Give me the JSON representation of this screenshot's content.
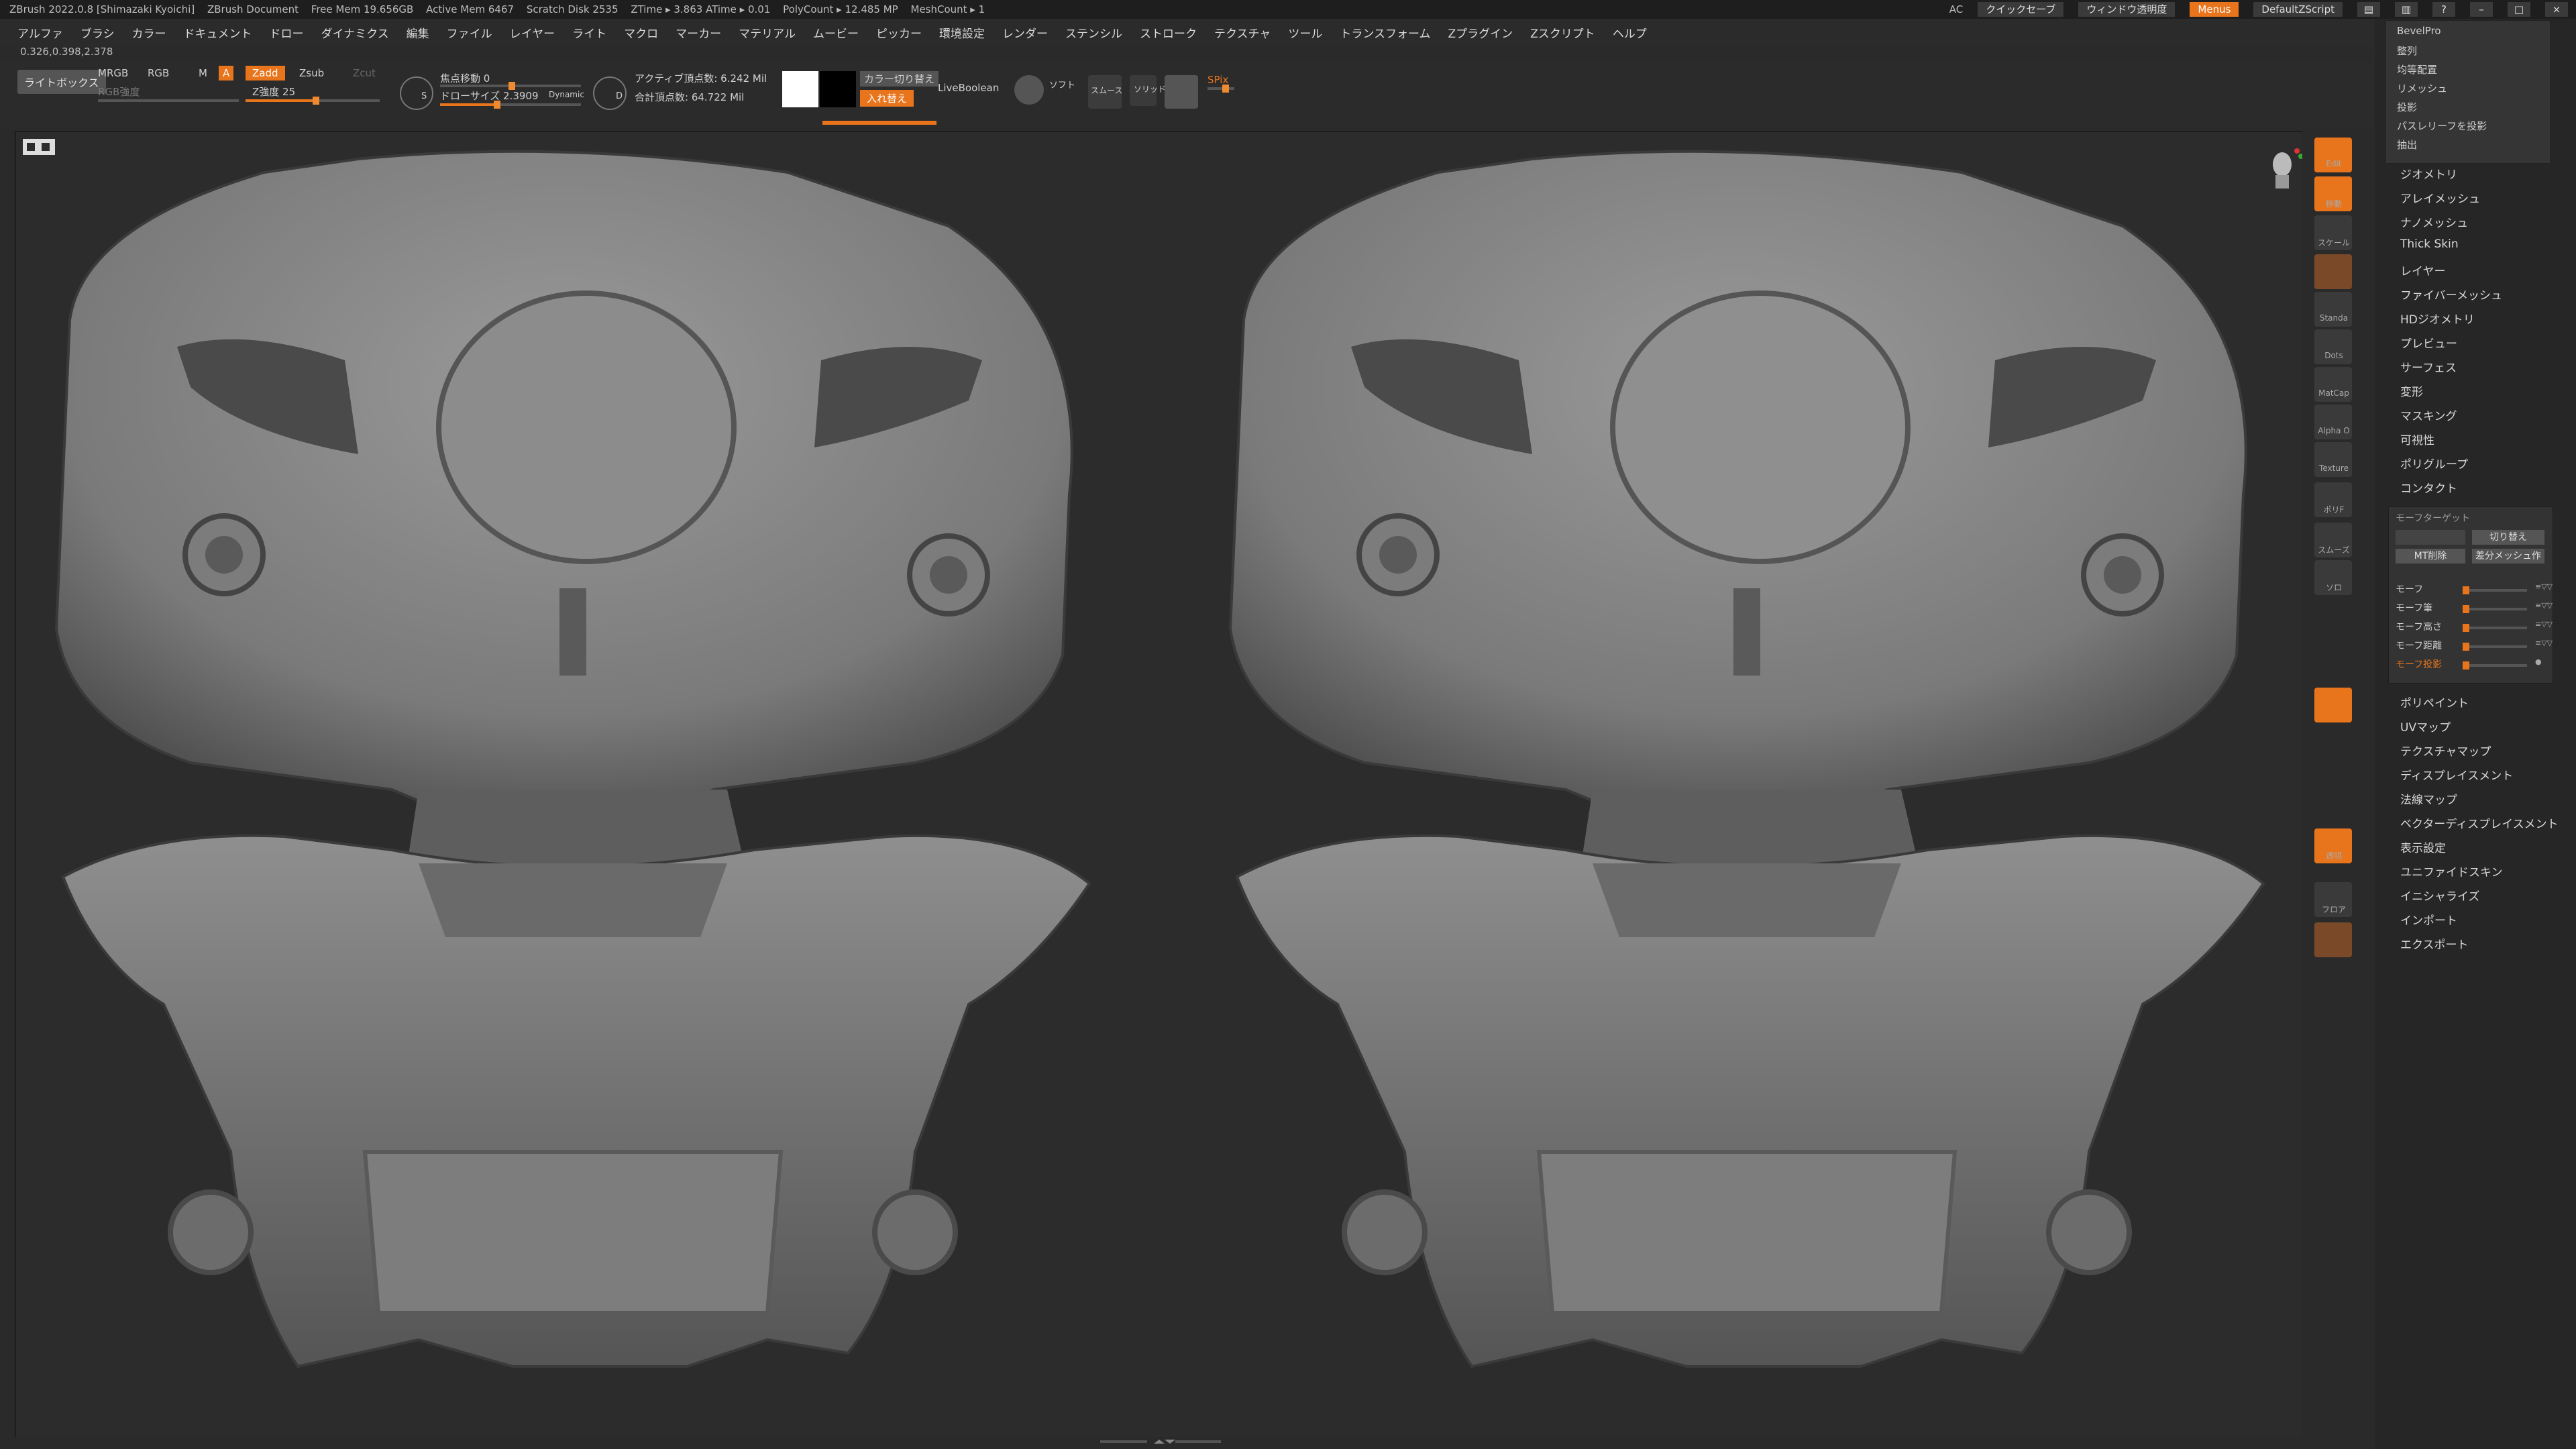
{
  "titlebar": {
    "app": "ZBrush 2022.0.8 [Shimazaki Kyoichi]",
    "doc": "ZBrush Document",
    "free_mem": "Free Mem 19.656GB",
    "active_mem": "Active Mem 6467",
    "scratch": "Scratch Disk 2535",
    "ztime": "ZTime ▸ 3.863 ATime ▸ 0.01",
    "polycount": "PolyCount ▸ 12.485 MP",
    "meshcount": "MeshCount ▸ 1",
    "ac": "AC",
    "quicksave": "クイックセーブ",
    "transparency": "ウィンドウ透明度",
    "menus": "Menus",
    "script": "DefaultZScript"
  },
  "menu": [
    "アルファ",
    "ブラシ",
    "カラー",
    "ドキュメント",
    "ドロー",
    "ダイナミクス",
    "編集",
    "ファイル",
    "レイヤー",
    "ライト",
    "マクロ",
    "マーカー",
    "マテリアル",
    "ムービー",
    "ピッカー",
    "環境設定",
    "レンダー",
    "ステンシル",
    "ストローク",
    "テクスチャ",
    "ツール",
    "トランスフォーム",
    "Zプラグイン",
    "Zスクリプト",
    "ヘルプ"
  ],
  "coords": "0.326,0.398,2.378",
  "shelf": {
    "lightbox": "ライトボックス",
    "mrgb": "MRGB",
    "rgb": "RGB",
    "m": "M",
    "a": "A",
    "zadd": "Zadd",
    "zsub": "Zsub",
    "zcut": "Zcut",
    "rgb_intensity": "RGB強度",
    "z_intensity": "Z強度 25",
    "focal_shift": "焦点移動 0",
    "draw_size": "ドローサイズ 2.3909",
    "dynamic": "Dynamic",
    "active_points": "アクティブ頂点数: 6.242 Mil",
    "total_points": "合計頂点数: 64.722 Mil",
    "color_switch": "カラー切り替え",
    "swap": "入れ替え",
    "liveboolean": "LiveBoolean",
    "spix": "SPix",
    "s_label": "S",
    "d_label": "D",
    "mini_labels": [
      "ソフト",
      "スムース",
      "ソリッド"
    ]
  },
  "tray_popup": [
    "BevelPro",
    "整列",
    "均等配置",
    "リメッシュ",
    "投影",
    "パスレリーフを投影",
    "抽出"
  ],
  "tray_items": [
    "ジオメトリ",
    "アレイメッシュ",
    "ナノメッシュ",
    "Thick Skin",
    "レイヤー",
    "ファイバーメッシュ",
    "HDジオメトリ",
    "プレビュー",
    "サーフェス",
    "変形",
    "マスキング",
    "可視性",
    "ポリグループ",
    "コンタクト"
  ],
  "morph": {
    "title": "モーフターゲット",
    "switch": "切り替え",
    "mt_delete": "MT削除",
    "diff_mesh": "差分メッシュ作",
    "sliders": [
      "モーフ",
      "モーフ筆",
      "モーフ高さ",
      "モーフ距離",
      "モーフ投影"
    ]
  },
  "tray_items2": [
    "ポリペイント",
    "UVマップ",
    "テクスチャマップ",
    "ディスプレイスメント",
    "法線マップ",
    "ベクターディスプレイスメント",
    "表示設定",
    "ユニファイドスキン",
    "イニシャライズ",
    "インポート",
    "エクスポート"
  ],
  "rtool_labels": [
    "Edit",
    "移動",
    "スケール",
    "Standa",
    "Dots",
    "MatCap",
    "Alpha O",
    "Texture",
    "ポリF",
    "スムーズ",
    "ソロ",
    "透明",
    "フロア"
  ]
}
